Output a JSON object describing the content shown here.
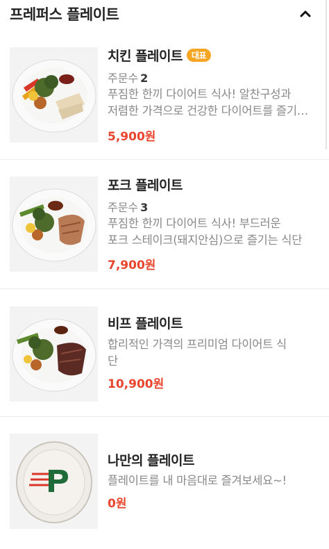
{
  "section": {
    "title": "프레퍼스 플레이트",
    "toggle_icon": "chevron-up-icon"
  },
  "badge_color": "#f6a623",
  "price_color": "#e8452c",
  "items": [
    {
      "name": "치킨 플레이트",
      "badge": "대표",
      "orders_label": "주문수",
      "orders_count": "2",
      "desc_lines": [
        "푸짐한 한끼 다이어트 식사! 알찬구성과",
        "저렴한 가격으로 건강한 다이어트를 즐기세요"
      ],
      "price": "5,900원",
      "image_icon": "chicken-plate-photo"
    },
    {
      "name": "포크 플레이트",
      "orders_label": "주문수",
      "orders_count": "3",
      "desc_lines": [
        "푸짐한 한끼 다이어트 식사! 부드러운",
        "포크 스테이크(돼지안심)으로 즐기는 식단"
      ],
      "price": "7,900원",
      "image_icon": "pork-plate-photo"
    },
    {
      "name": "비프 플레이트",
      "desc_lines": [
        "합리적인 가격의 프리미엄 다이어트 식",
        "단"
      ],
      "price": "10,900원",
      "image_icon": "beef-plate-photo"
    },
    {
      "name": "나만의 플레이트",
      "desc_lines": [
        "플레이트를 내 마음대로 즐겨보세요~!"
      ],
      "price": "0원",
      "image_icon": "empty-plate-photo"
    }
  ]
}
